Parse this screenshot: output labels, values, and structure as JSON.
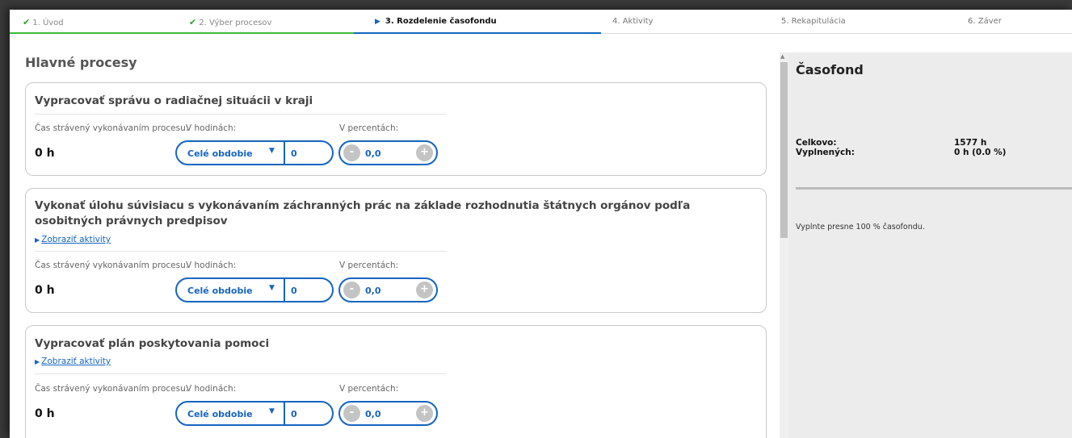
{
  "steps": [
    {
      "label": "1. Úvod",
      "state": "done"
    },
    {
      "label": "2. Výber procesov",
      "state": "done"
    },
    {
      "label": "3. Rozdelenie časofondu",
      "state": "active"
    },
    {
      "label": "4. Aktivity",
      "state": "todo"
    },
    {
      "label": "5. Rekapitulácia",
      "state": "todo"
    },
    {
      "label": "6. Záver",
      "state": "todo"
    }
  ],
  "main": {
    "title": "Hlavné procesy",
    "time_label": "Čas strávený vykonávaním procesu:",
    "hours_label": "V hodinách:",
    "percent_label": "V percentách:",
    "show_activities": "Zobraziť aktivity",
    "processes": [
      {
        "title": "Vypracovať správu o radiačnej situácii v kraji",
        "hours": "0 h",
        "period": "Celé obdobie",
        "hours_value": "0",
        "percent_value": "0,0"
      },
      {
        "title": "Vykonať úlohu súvisiacu s vykonávaním záchranných prác na základe rozhodnutia štátnych orgánov podľa osobitných právnych predpisov",
        "hours": "0 h",
        "period": "Celé obdobie",
        "hours_value": "0",
        "percent_value": "0,0"
      },
      {
        "title": "Vypracovať plán poskytovania pomoci",
        "hours": "0 h",
        "period": "Celé obdobie",
        "hours_value": "0",
        "percent_value": "0,0"
      }
    ]
  },
  "panel": {
    "title": "Časofond",
    "total_label": "Celkovo:",
    "total_value": "1577 h",
    "filled_label": "Vyplnených:",
    "filled_value": "0 h (0.0 %)",
    "note": "Vyplnte presne 100 % časofondu."
  },
  "icons": {
    "done": "check-icon",
    "active": "triangle-right-icon",
    "expand": "triangle-right-icon",
    "dropdown": "caret-down-icon"
  },
  "colors": {
    "accent": "#1565c0",
    "done": "#3bbd3b"
  }
}
